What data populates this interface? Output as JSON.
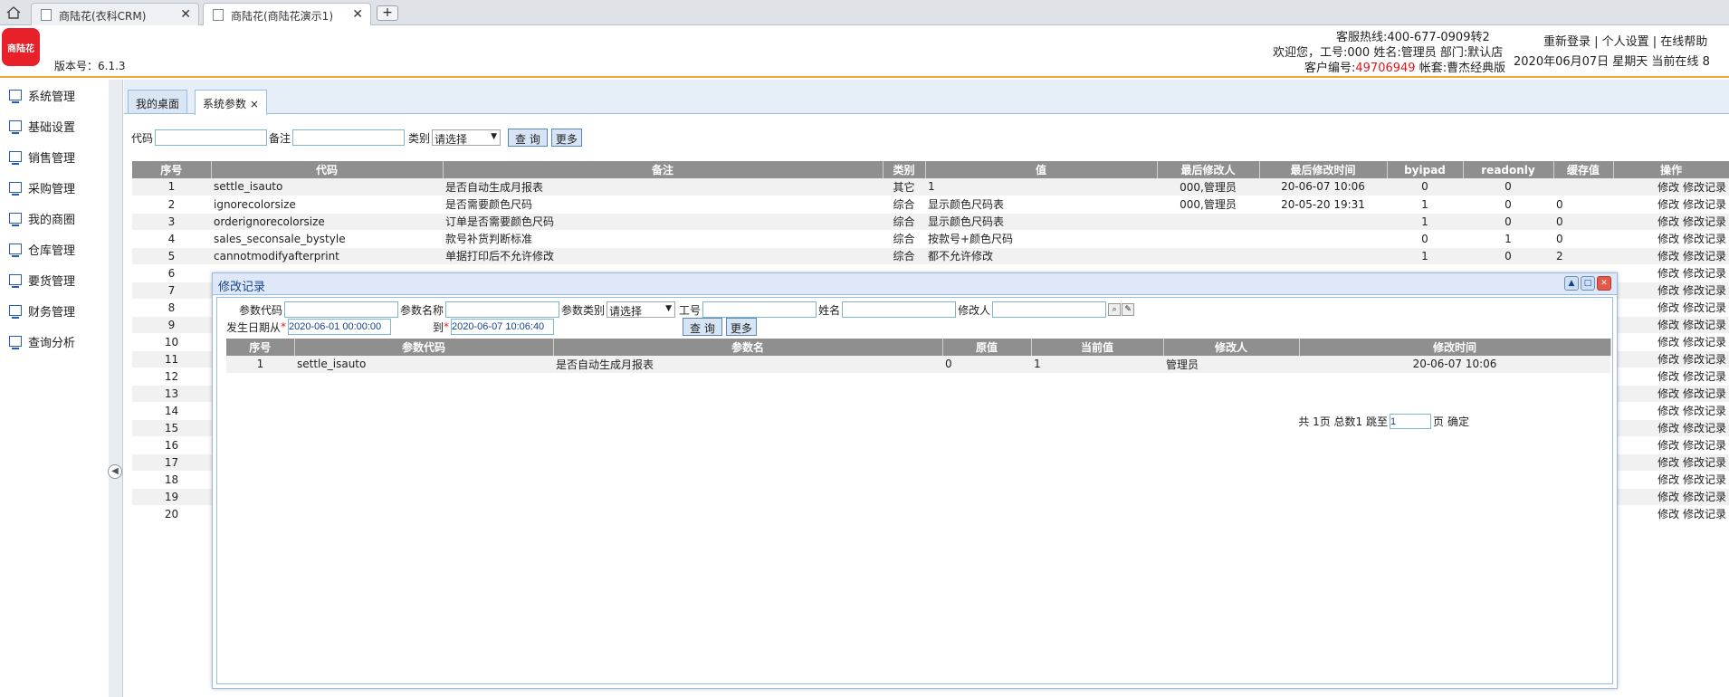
{
  "browser": {
    "tabs": [
      {
        "title": "商陆花(衣科CRM)"
      },
      {
        "title": "商陆花(商陆花演示1)"
      }
    ],
    "new_tab": "+"
  },
  "header": {
    "logo_text": "商陆花",
    "version": "版本号：6.1.3",
    "hotline": "客服热线:400-677-0909转2",
    "welcome": "欢迎您，工号:000 姓名:管理员 部门:默认店",
    "customer_label": "客户编号:",
    "customer_no": "49706949",
    "account": " 帐套:曹杰经典版",
    "links": "重新登录 | 个人设置 | 在线帮助",
    "datetime": "2020年06月07日 星期天 当前在线 8"
  },
  "sidebar": {
    "items": [
      {
        "label": "系统管理"
      },
      {
        "label": "基础设置"
      },
      {
        "label": "销售管理"
      },
      {
        "label": "采购管理"
      },
      {
        "label": "我的商圈"
      },
      {
        "label": "仓库管理"
      },
      {
        "label": "要货管理"
      },
      {
        "label": "财务管理"
      },
      {
        "label": "查询分析"
      }
    ],
    "collapse": "◀"
  },
  "tabs": {
    "desktop": "我的桌面",
    "params": "系统参数",
    "close": "×"
  },
  "filter": {
    "code_label": "代码",
    "remark_label": "备注",
    "category_label": "类别",
    "category_value": "请选择",
    "query_btn": "查 询",
    "more_btn": "更多"
  },
  "table": {
    "headers": [
      "序号",
      "代码",
      "备注",
      "类别",
      "值",
      "最后修改人",
      "最后修改时间",
      "byipad",
      "readonly",
      "缓存值",
      "操作"
    ],
    "rows": [
      {
        "no": "1",
        "code": "settle_isauto",
        "remark": "是否自动生成月报表",
        "cat": "其它",
        "val": "1",
        "modby": "000,管理员",
        "modtime": "20-06-07 10:06",
        "byipad": "0",
        "readonly": "0",
        "cache": "",
        "ops": "修改 修改记录"
      },
      {
        "no": "2",
        "code": "ignorecolorsize",
        "remark": "是否需要颜色尺码",
        "cat": "综合",
        "val": "显示颜色尺码表",
        "modby": "000,管理员",
        "modtime": "20-05-20 19:31",
        "byipad": "1",
        "readonly": "0",
        "cache": "0",
        "ops": "修改 修改记录"
      },
      {
        "no": "3",
        "code": "orderignorecolorsize",
        "remark": "订单是否需要颜色尺码",
        "cat": "综合",
        "val": "显示颜色尺码表",
        "modby": "",
        "modtime": "",
        "byipad": "1",
        "readonly": "0",
        "cache": "0",
        "ops": "修改 修改记录"
      },
      {
        "no": "4",
        "code": "sales_seconsale_bystyle",
        "remark": "款号补货判断标准",
        "cat": "综合",
        "val": "按款号+颜色尺码",
        "modby": "",
        "modtime": "",
        "byipad": "0",
        "readonly": "1",
        "cache": "0",
        "ops": "修改 修改记录"
      },
      {
        "no": "5",
        "code": "cannotmodifyafterprint",
        "remark": "单据打印后不允许修改",
        "cat": "综合",
        "val": "都不允许修改",
        "modby": "",
        "modtime": "",
        "byipad": "1",
        "readonly": "0",
        "cache": "2",
        "ops": "修改 修改记录"
      },
      {
        "no": "6",
        "code": "",
        "remark": "",
        "cat": "",
        "val": "",
        "modby": "",
        "modtime": "",
        "byipad": "",
        "readonly": "",
        "cache": "",
        "ops": "修改 修改记录"
      },
      {
        "no": "7",
        "code": "",
        "remark": "",
        "cat": "",
        "val": "",
        "modby": "",
        "modtime": "",
        "byipad": "",
        "readonly": "",
        "cache": "",
        "ops": "修改 修改记录"
      },
      {
        "no": "8",
        "code": "",
        "remark": "",
        "cat": "",
        "val": "",
        "modby": "",
        "modtime": "",
        "byipad": "",
        "readonly": "",
        "cache": "",
        "ops": "修改 修改记录"
      },
      {
        "no": "9",
        "code": "",
        "remark": "",
        "cat": "",
        "val": "",
        "modby": "",
        "modtime": "",
        "byipad": "",
        "readonly": "",
        "cache": "",
        "ops": "修改 修改记录"
      },
      {
        "no": "10",
        "code": "",
        "remark": "",
        "cat": "",
        "val": "",
        "modby": "",
        "modtime": "",
        "byipad": "",
        "readonly": "",
        "cache": "",
        "ops": "修改 修改记录"
      },
      {
        "no": "11",
        "code": "",
        "remark": "",
        "cat": "",
        "val": "",
        "modby": "",
        "modtime": "",
        "byipad": "",
        "readonly": "",
        "cache": "",
        "ops": "修改 修改记录"
      },
      {
        "no": "12",
        "code": "",
        "remark": "",
        "cat": "",
        "val": "",
        "modby": "",
        "modtime": "",
        "byipad": "",
        "readonly": "",
        "cache": "",
        "ops": "修改 修改记录"
      },
      {
        "no": "13",
        "code": "",
        "remark": "",
        "cat": "",
        "val": "",
        "modby": "",
        "modtime": "",
        "byipad": "",
        "readonly": "",
        "cache": "",
        "ops": "修改 修改记录"
      },
      {
        "no": "14",
        "code": "",
        "remark": "",
        "cat": "",
        "val": "",
        "modby": "",
        "modtime": "",
        "byipad": "",
        "readonly": "",
        "cache": "",
        "ops": "修改 修改记录"
      },
      {
        "no": "15",
        "code": "",
        "remark": "",
        "cat": "",
        "val": "",
        "modby": "",
        "modtime": "",
        "byipad": "",
        "readonly": "",
        "cache": "",
        "ops": "修改 修改记录"
      },
      {
        "no": "16",
        "code": "",
        "remark": "",
        "cat": "",
        "val": "",
        "modby": "",
        "modtime": "",
        "byipad": "",
        "readonly": "",
        "cache": "",
        "ops": "修改 修改记录"
      },
      {
        "no": "17",
        "code": "",
        "remark": "",
        "cat": "",
        "val": "",
        "modby": "",
        "modtime": "",
        "byipad": "",
        "readonly": "",
        "cache": "",
        "ops": "修改 修改记录"
      },
      {
        "no": "18",
        "code": "",
        "remark": "",
        "cat": "",
        "val": "",
        "modby": "",
        "modtime": "",
        "byipad": "",
        "readonly": "",
        "cache": "",
        "ops": "修改 修改记录"
      },
      {
        "no": "19",
        "code": "",
        "remark": "",
        "cat": "",
        "val": "",
        "modby": "",
        "modtime": "",
        "byipad": "",
        "readonly": "",
        "cache": "",
        "ops": "修改 修改记录"
      },
      {
        "no": "20",
        "code": "",
        "remark": "",
        "cat": "",
        "val": "",
        "modby": "",
        "modtime": "",
        "byipad": "",
        "readonly": "",
        "cache": "",
        "ops": "修改 修改记录"
      }
    ]
  },
  "dialog": {
    "title": "修改记录",
    "param_code_label": "参数代码",
    "param_name_label": "参数名称",
    "param_cat_label": "参数类别",
    "param_cat_value": "请选择",
    "emp_no_label": "工号",
    "name_label": "姓名",
    "modifier_label": "修改人",
    "date_from_label": "发生日期从",
    "date_from_value": "2020-06-01 00:00:00",
    "date_to_label": "到",
    "date_to_value": "2020-06-07 10:06:40",
    "required_mark": "*",
    "query_btn": "查 询",
    "more_btn": "更多",
    "headers": [
      "序号",
      "参数代码",
      "参数名",
      "原值",
      "当前值",
      "修改人",
      "修改时间"
    ],
    "rows": [
      {
        "no": "1",
        "code": "settle_isauto",
        "name": "是否自动生成月报表",
        "old": "0",
        "cur": "1",
        "modifier": "管理员",
        "time": "20-06-07 10:06"
      }
    ],
    "pager": {
      "summary": "共 1页 总数1 跳至",
      "page_value": "1",
      "page_suffix": "页",
      "confirm": "确定"
    }
  }
}
